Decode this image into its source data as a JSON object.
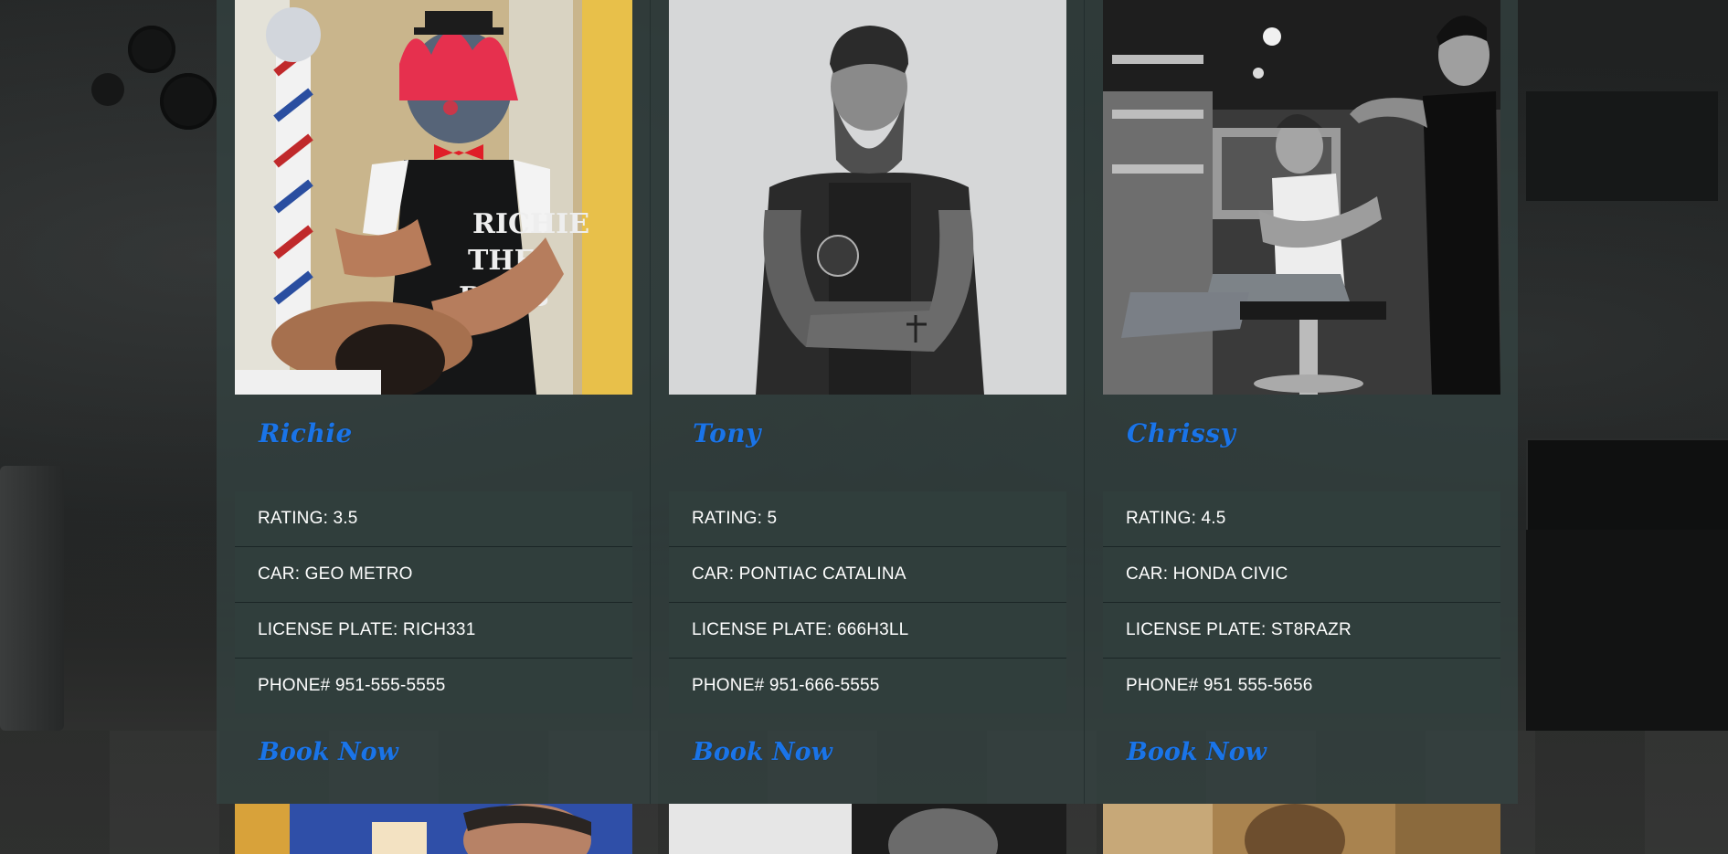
{
  "barbers": [
    {
      "name": "Richie",
      "photo_icon": "barber-photo-richie",
      "rating": "RATING: 3.5",
      "car": "CAR: GEO METRO",
      "plate": "LICENSE PLATE: RICH331",
      "phone": "PHONE# 951-555-5555",
      "book_label": "Book Now"
    },
    {
      "name": "Tony",
      "photo_icon": "barber-photo-tony",
      "rating": "RATING: 5",
      "car": "CAR: PONTIAC CATALINA",
      "plate": "LICENSE PLATE: 666H3LL",
      "phone": "PHONE# 951-666-5555",
      "book_label": "Book Now"
    },
    {
      "name": "Chrissy",
      "photo_icon": "barber-photo-chrissy",
      "rating": "RATING: 4.5",
      "car": "CAR: HONDA CIVIC",
      "plate": "LICENSE PLATE: ST8RAZR",
      "phone": "PHONE# 951 555-5656",
      "book_label": "Book Now"
    }
  ],
  "colors": {
    "accent_link": "#1a74e8",
    "panel": "#344442",
    "text": "#ffffff"
  }
}
